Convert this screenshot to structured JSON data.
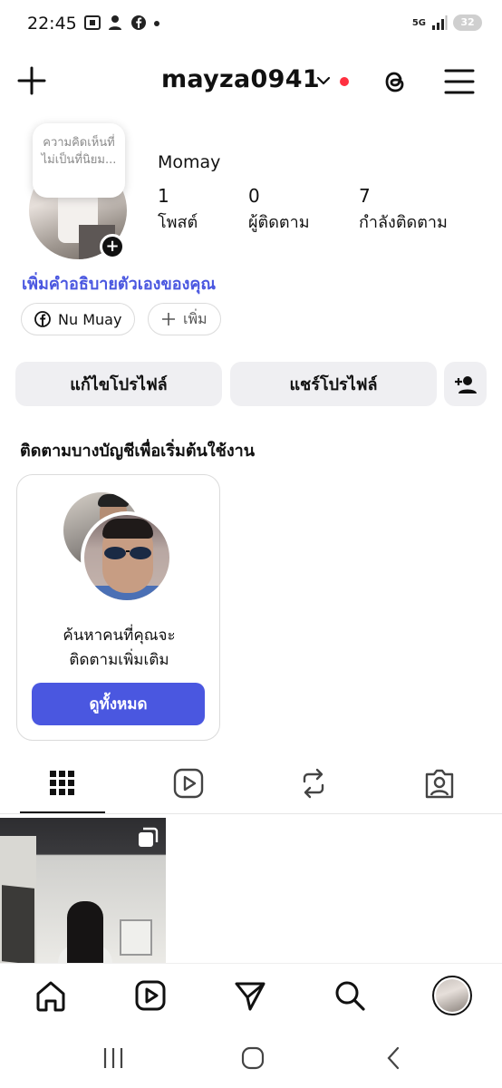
{
  "status_bar": {
    "time": "22:45",
    "network": "5G",
    "battery": "32"
  },
  "header": {
    "username": "mayza0941",
    "icons": [
      "plus-icon",
      "chevron-down-icon",
      "threads-icon",
      "menu-icon"
    ],
    "notification_dot_color": "#ff3040"
  },
  "profile": {
    "note": "ความคิดเห็นที่ไม่เป็นที่นิยม...",
    "display_name": "Momay",
    "stats": [
      {
        "value": "1",
        "label": "โพสต์"
      },
      {
        "value": "0",
        "label": "ผู้ติดตาม"
      },
      {
        "value": "7",
        "label": "กำลังติดตาม"
      }
    ],
    "bio_prompt": "เพิ่มคำอธิบายตัวเองของคุณ",
    "link_chip": "Nu Muay",
    "add_chip": "เพิ่ม"
  },
  "actions": {
    "edit_profile": "แก้ไขโปรไฟล์",
    "share_profile": "แชร์โปรไฟล์"
  },
  "suggestions": {
    "title": "ติดตามบางบัญชีเพื่อเริ่มต้นใช้งาน",
    "card_text_line1": "ค้นหาคนที่คุณจะ",
    "card_text_line2": "ติดตามเพิ่มเติม",
    "button": "ดูทั้งหมด"
  },
  "colors": {
    "accent": "#4a57e0",
    "button_bg": "#efeff2"
  }
}
